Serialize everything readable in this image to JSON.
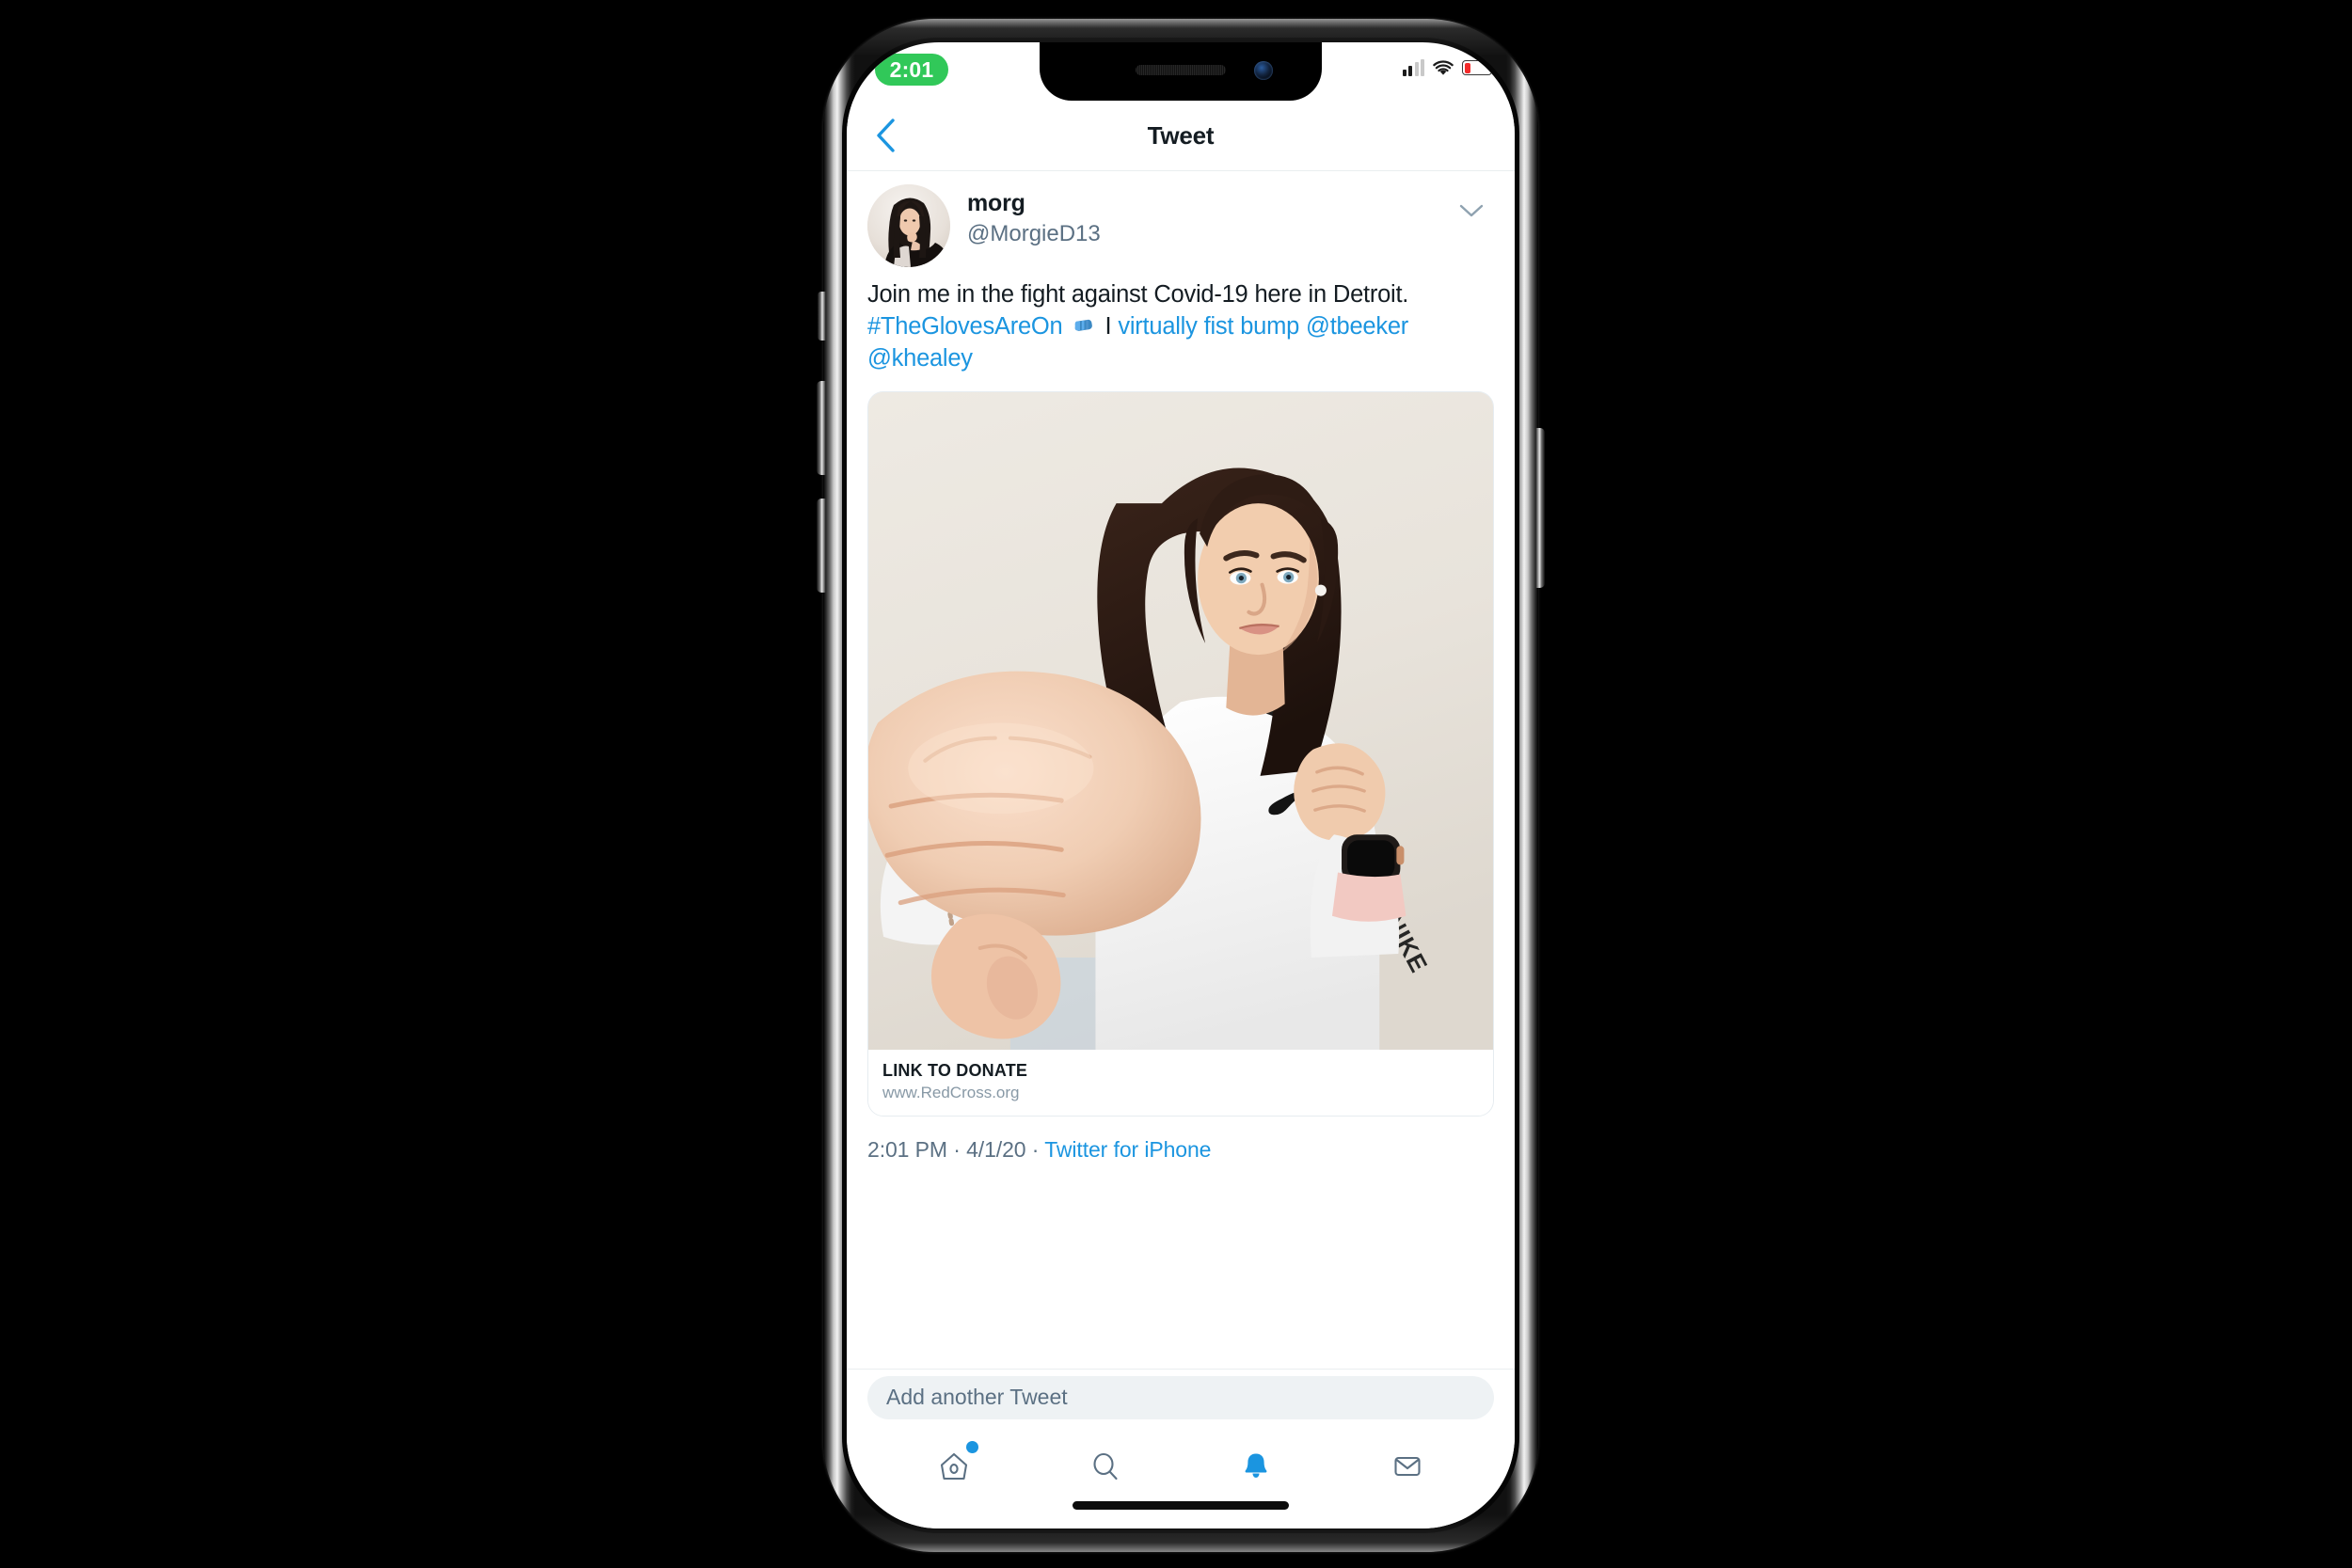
{
  "status_bar": {
    "time": "2:01",
    "time_pill_color": "#31c859",
    "signal_icon": "cellular-signal-icon",
    "signal_bars_active": 2,
    "signal_bars_total": 4,
    "wifi_icon": "wifi-icon",
    "battery_icon": "battery-icon",
    "battery_percent": 20,
    "battery_color": "#f42b2b"
  },
  "nav_bar": {
    "back_icon": "chevron-left-icon",
    "title": "Tweet",
    "accent_color": "#1b95e0"
  },
  "tweet": {
    "avatar_icon": "user-avatar",
    "author_name": "morg",
    "author_handle": "@MorgieD13",
    "menu_icon": "chevron-down-icon",
    "text_parts": [
      {
        "text": "Join me in the fight against Covid-19 here in Detroit. ",
        "type": "plain"
      },
      {
        "text": "#TheGlovesAreOn",
        "type": "link"
      },
      {
        "text": " ",
        "type": "plain"
      },
      {
        "text": "fist-bump-emoji",
        "type": "emoji"
      },
      {
        "text": " I ",
        "type": "plain"
      },
      {
        "text": "virtually fist bump @tbeeker @khealey",
        "type": "link"
      }
    ],
    "text_plain": "Join me in the fight against Covid-19 here in Detroit. #TheGlovesAreOn 👊 I virtually fist bump @tbeeker @khealey",
    "media": {
      "image_icon": "photo-woman-fist-bump",
      "alt": "Woman in white Nike long-sleeve shirt punching toward camera"
    },
    "link_card": {
      "title": "LINK TO DONATE",
      "url": "www.RedCross.org"
    },
    "meta": {
      "time": "2:01 PM",
      "separator_1": " · ",
      "date": "4/1/20",
      "separator_2": " · ",
      "source": "Twitter for iPhone"
    }
  },
  "compose": {
    "placeholder": "Add another Tweet"
  },
  "tab_bar": {
    "items": [
      {
        "icon": "home-icon",
        "label": "Home",
        "active": false,
        "badge": true
      },
      {
        "icon": "search-icon",
        "label": "Search",
        "active": false,
        "badge": false
      },
      {
        "icon": "bell-icon",
        "label": "Notifications",
        "active": true,
        "badge": false
      },
      {
        "icon": "envelope-icon",
        "label": "Messages",
        "active": false,
        "badge": false
      }
    ],
    "active_color": "#1b95e0",
    "inactive_color": "#5b7083"
  },
  "device": {
    "notch_icons": [
      "speaker-grille",
      "front-camera"
    ],
    "side_buttons": [
      "mute-switch",
      "volume-up",
      "volume-down",
      "power-button"
    ],
    "home_indicator": "home-indicator"
  }
}
